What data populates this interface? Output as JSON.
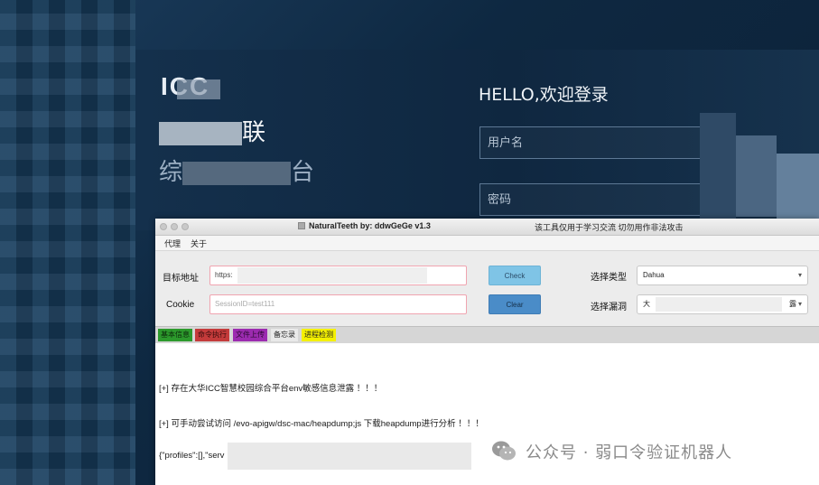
{
  "background_login": {
    "logo_text": "ICC",
    "platform_name_end": "联",
    "platform_sub_start": "综",
    "platform_sub_end": "台",
    "hello_text": "HELLO,欢迎登录",
    "username_placeholder": "用户名",
    "password_placeholder": "密码"
  },
  "window": {
    "title": "NaturalTeeth  by: ddwGeGe v1.3",
    "notice": "该工具仅用于学习交流 切勿用作非法攻击",
    "menu": [
      "代理",
      "关于"
    ]
  },
  "form": {
    "target_label": "目标地址",
    "target_value": "https:",
    "cookie_label": "Cookie",
    "cookie_placeholder": "SessionID=test111",
    "check_button": "Check",
    "clear_button": "Clear",
    "type_label": "选择类型",
    "type_value": "Dahua",
    "vuln_label": "选择漏洞",
    "vuln_value_start": "大",
    "vuln_value_end": "露"
  },
  "tabs": [
    {
      "label": "基本信息",
      "bg": "#2c9a2c",
      "color": "#0b2a0b"
    },
    {
      "label": "命令执行",
      "bg": "#c43b3b",
      "color": "#3a0c0c"
    },
    {
      "label": "文件上传",
      "bg": "#9c2bb0",
      "color": "#2c0a33"
    },
    {
      "label": "备忘录",
      "bg": "#e9e9e9",
      "color": "#222222"
    },
    {
      "label": "进程检测",
      "bg": "#f4f000",
      "color": "#222222"
    }
  ],
  "output_lines": [
    "[+] 存在大华ICC智慧校园综合平台env敏感信息泄露 ！！！",
    "[+] 可手动尝试访问 /evo-apigw/dsc-mac/heapdump;js 下载heapdump进行分析 ！！！",
    "{\"profiles\":[],\"serv"
  ],
  "watermark": {
    "text": "公众号 · 弱口令验证机器人"
  }
}
